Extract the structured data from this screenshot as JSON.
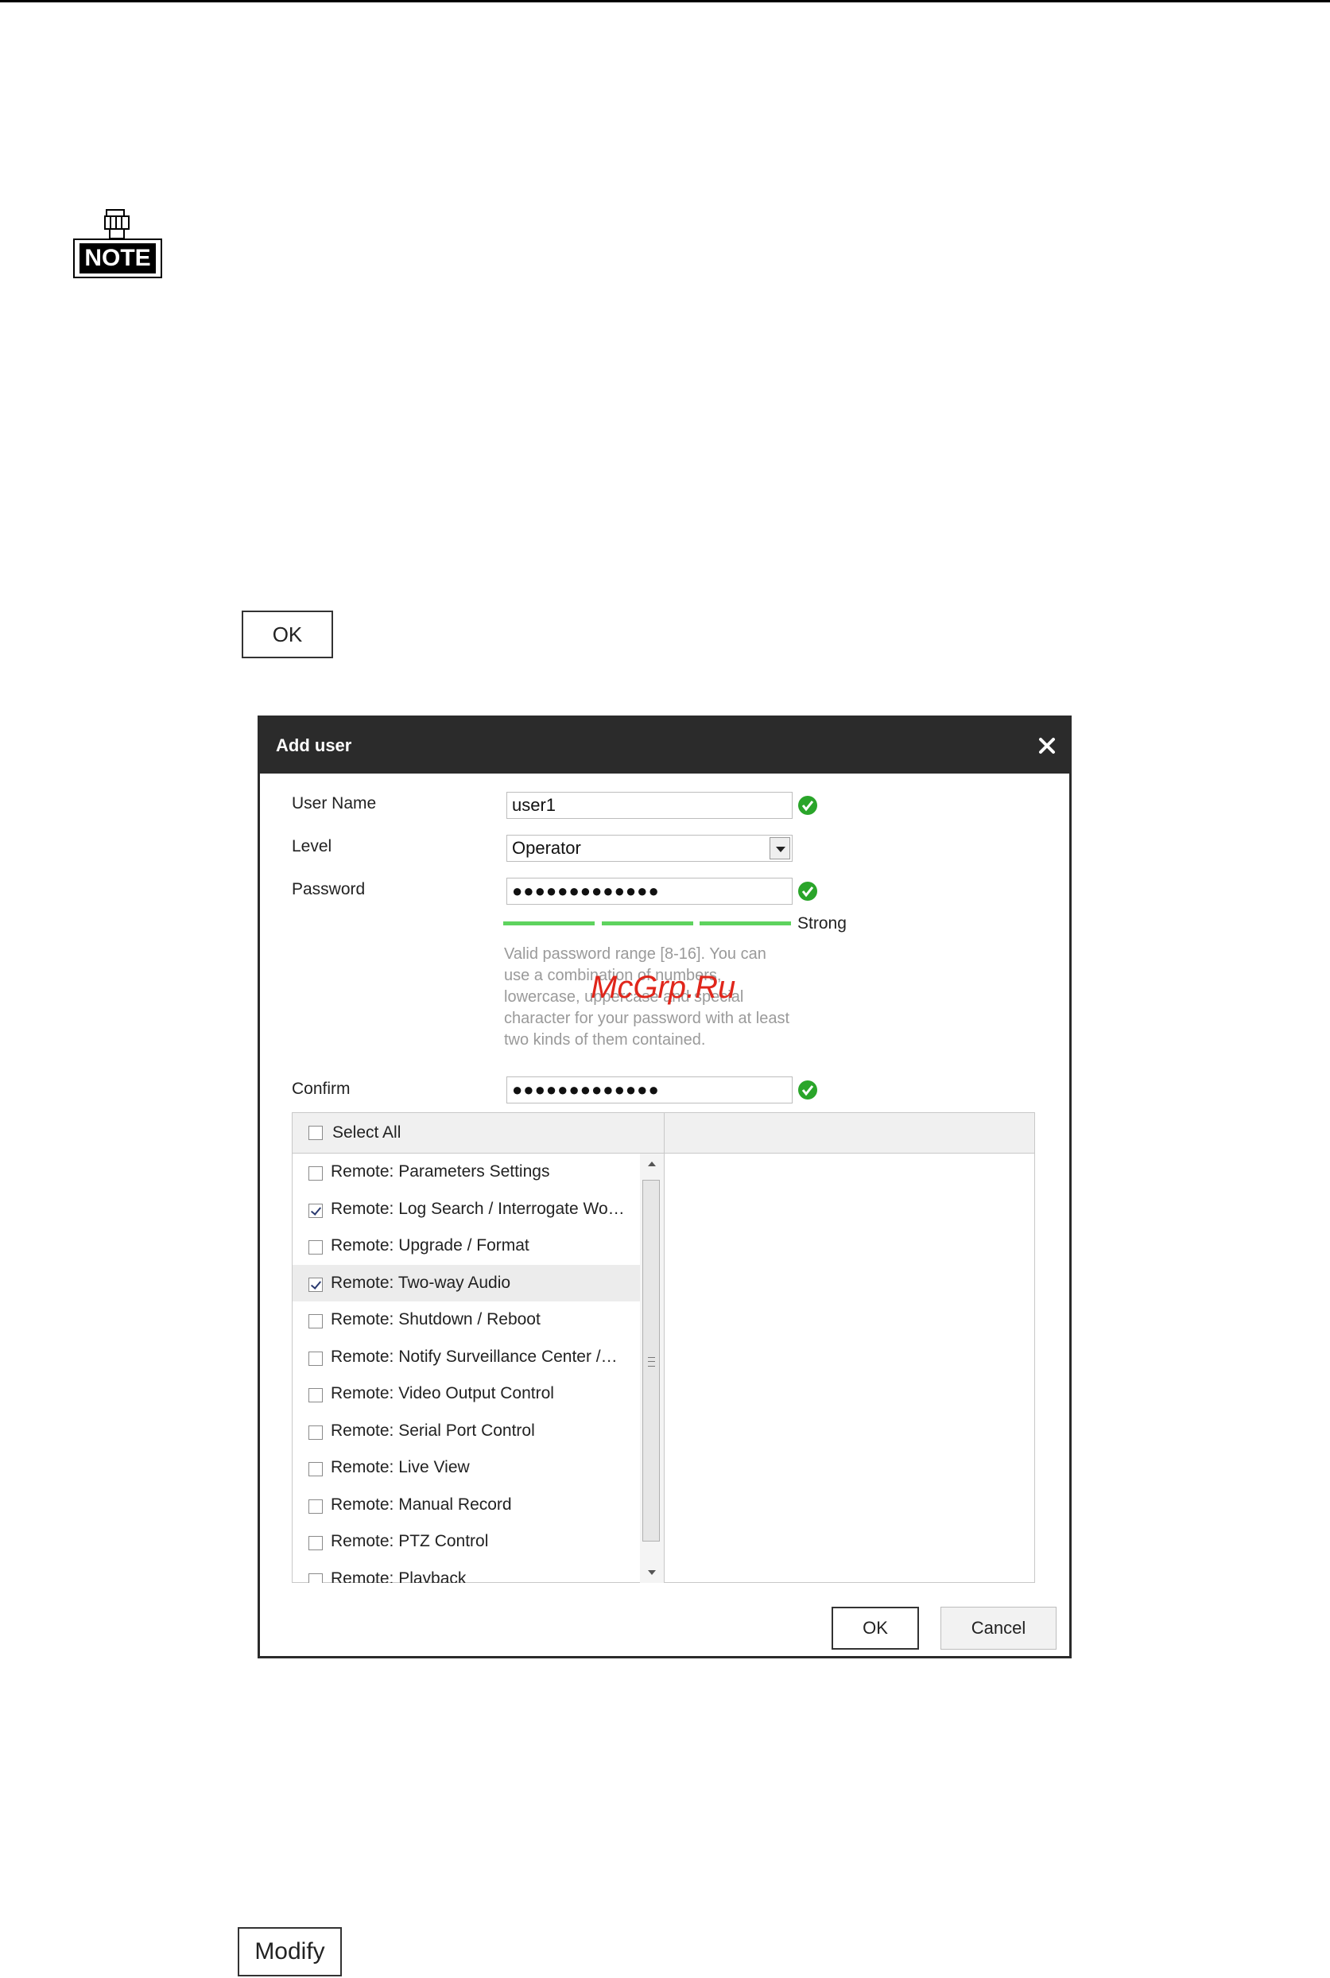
{
  "note_icon": {
    "label": "NOTE"
  },
  "standalone_buttons": {
    "ok_label": "OK",
    "modify_label": "Modify"
  },
  "watermark": "McGrp.Ru",
  "dialog": {
    "title": "Add user",
    "close_icon": "close-icon",
    "fields": {
      "user_name_label": "User Name",
      "user_name_value": "user1",
      "level_label": "Level",
      "level_value": "Operator",
      "password_label": "Password",
      "password_masked": "●●●●●●●●●●●●●",
      "confirm_label": "Confirm",
      "confirm_masked": "●●●●●●●●●●●●●"
    },
    "password_strength": {
      "label": "Strong",
      "segments_filled": 3,
      "segments_total": 3,
      "color": "#5ed35e"
    },
    "password_hint": "Valid password range [8-16]. You can use a combination of numbers, lowercase, uppercase and special character for your password with at least two kinds of them contained.",
    "permissions": {
      "select_all_label": "Select All",
      "select_all_checked": false,
      "items": [
        {
          "label": "Remote: Parameters Settings",
          "checked": false,
          "selected": false
        },
        {
          "label": "Remote: Log Search / Interrogate Wo…",
          "checked": true,
          "selected": false
        },
        {
          "label": "Remote: Upgrade / Format",
          "checked": false,
          "selected": false
        },
        {
          "label": "Remote: Two-way Audio",
          "checked": true,
          "selected": true
        },
        {
          "label": "Remote: Shutdown / Reboot",
          "checked": false,
          "selected": false
        },
        {
          "label": "Remote: Notify Surveillance Center /…",
          "checked": false,
          "selected": false
        },
        {
          "label": "Remote: Video Output Control",
          "checked": false,
          "selected": false
        },
        {
          "label": "Remote: Serial Port Control",
          "checked": false,
          "selected": false
        },
        {
          "label": "Remote: Live View",
          "checked": false,
          "selected": false
        },
        {
          "label": "Remote: Manual Record",
          "checked": false,
          "selected": false
        },
        {
          "label": "Remote: PTZ Control",
          "checked": false,
          "selected": false
        },
        {
          "label": "Remote: Playback",
          "checked": false,
          "selected": false
        }
      ]
    },
    "buttons": {
      "ok_label": "OK",
      "cancel_label": "Cancel"
    },
    "colors": {
      "header_bg": "#2b2b2b",
      "valid_green": "#2aa52a"
    }
  }
}
